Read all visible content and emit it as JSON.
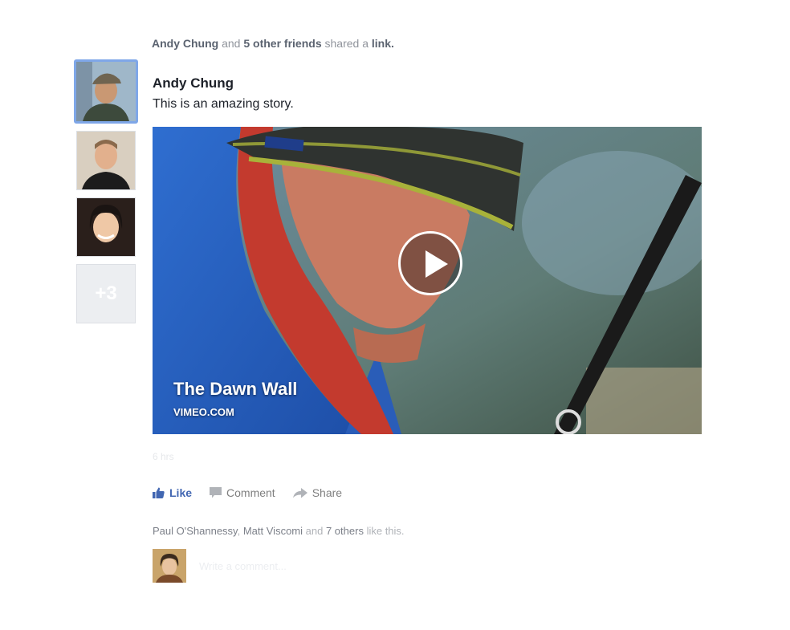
{
  "story_header": {
    "actor": "Andy Chung",
    "connector": "and",
    "others": "5 other friends",
    "verb": "shared a",
    "object": "link."
  },
  "sharers": {
    "more_count": "+3"
  },
  "post": {
    "author": "Andy Chung",
    "message": "This is an amazing story.",
    "link": {
      "title": "The Dawn Wall",
      "domain": "VIMEO.COM"
    },
    "timestamp": "6 hrs"
  },
  "actions": {
    "like": "Like",
    "comment": "Comment",
    "share": "Share"
  },
  "likes_summary": {
    "name1": "Paul O'Shannessy",
    "sep": ",",
    "name2": "Matt Viscomi",
    "connector": "and",
    "others": "7 others",
    "suffix": "like this."
  },
  "composer": {
    "placeholder": "Write a comment..."
  },
  "colors": {
    "like_blue": "#4267b2",
    "selected_avatar_border": "#7fa7e8"
  }
}
